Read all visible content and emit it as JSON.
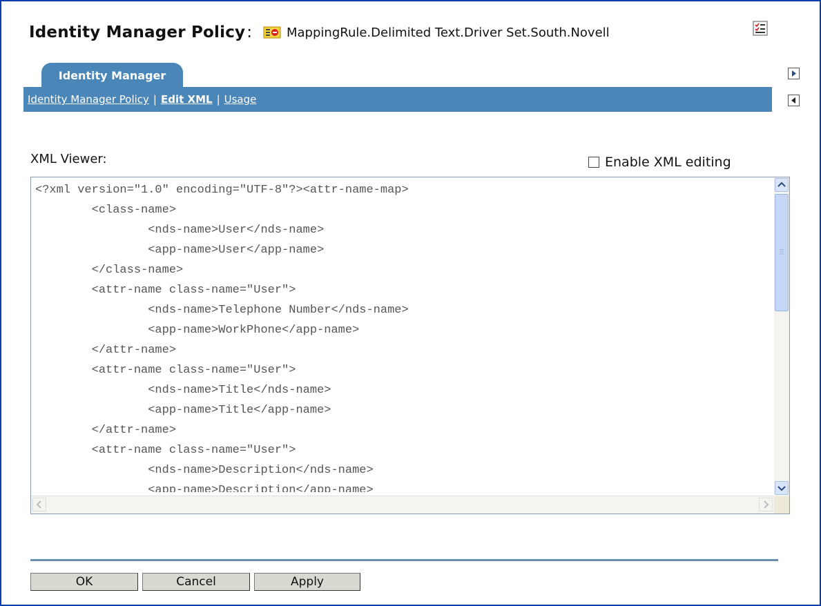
{
  "header": {
    "title": "Identity Manager Policy",
    "colon": ":",
    "object_name": "MappingRule.Delimited Text.Driver Set.South.Novell"
  },
  "tabs": [
    {
      "label": "Identity Manager"
    }
  ],
  "nav": {
    "links": [
      "Identity Manager Policy",
      "Edit XML",
      "Usage"
    ],
    "separator": "|"
  },
  "viewer": {
    "label": "XML Viewer:",
    "enable_label": "Enable XML editing",
    "enable_checked": false,
    "xml": "<?xml version=\"1.0\" encoding=\"UTF-8\"?><attr-name-map>\n        <class-name>\n                <nds-name>User</nds-name>\n                <app-name>User</app-name>\n        </class-name>\n        <attr-name class-name=\"User\">\n                <nds-name>Telephone Number</nds-name>\n                <app-name>WorkPhone</app-name>\n        </attr-name>\n        <attr-name class-name=\"User\">\n                <nds-name>Title</nds-name>\n                <app-name>Title</app-name>\n        </attr-name>\n        <attr-name class-name=\"User\">\n                <nds-name>Description</nds-name>\n                <app-name>Description</app-name>"
  },
  "buttons": {
    "ok": "OK",
    "cancel": "Cancel",
    "apply": "Apply"
  },
  "colors": {
    "accent": "#4a86b8",
    "frame": "#0a3cb4"
  },
  "icons": [
    "policy-object-icon",
    "help-checklist-icon",
    "arrow-right-icon",
    "arrow-left-icon",
    "scroll-up-icon",
    "scroll-down-icon",
    "scroll-left-icon",
    "scroll-right-icon"
  ]
}
